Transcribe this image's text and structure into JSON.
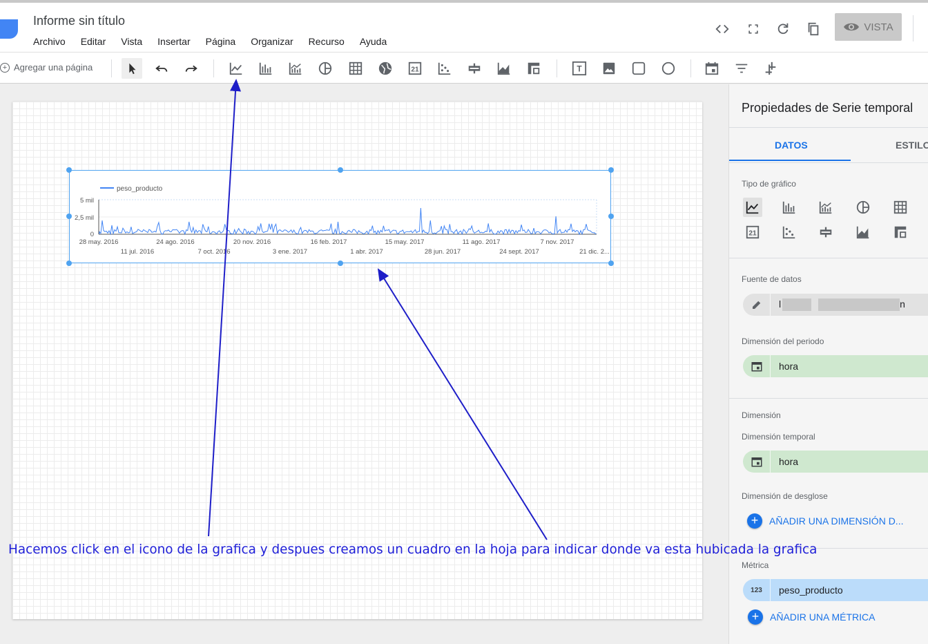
{
  "header": {
    "doc_title": "Informe sin título",
    "menu": [
      "Archivo",
      "Editar",
      "Vista",
      "Insertar",
      "Página",
      "Organizar",
      "Recurso",
      "Ayuda"
    ],
    "view_button": "VISTA"
  },
  "toolbar": {
    "add_page": "Agregar una página"
  },
  "chart": {
    "legend": "peso_producto",
    "y_ticks": [
      "5 mil",
      "2,5 mil",
      "0"
    ],
    "x_ticks_top": [
      "28 may. 2016",
      "24 ago. 2016",
      "20 nov. 2016",
      "16 feb. 2017",
      "15 may. 2017",
      "11 ago. 2017",
      "7 nov. 2017"
    ],
    "x_ticks_bottom": [
      "11 jul. 2016",
      "7 oct. 2016",
      "3 ene. 2017",
      "1 abr. 2017",
      "28 jun. 2017",
      "24 sept. 2017",
      "21 dic. 2..."
    ],
    "line_color": "#4285f4"
  },
  "panel": {
    "title": "Propiedades de Serie temporal",
    "tab_data": "DATOS",
    "tab_style": "ESTILO",
    "chart_type_label": "Tipo de gráfico",
    "source_label": "Fuente de datos",
    "source_visible_start": "l",
    "source_visible_end": "n",
    "period_dim_label": "Dimensión del periodo",
    "period_dim_value": "hora",
    "dimension_label": "Dimensión",
    "time_dim_label": "Dimensión temporal",
    "time_dim_value": "hora",
    "breakdown_label": "Dimensión de desglose",
    "add_dimension": "AÑADIR UNA DIMENSIÓN D...",
    "metric_label": "Métrica",
    "metric_value": "peso_producto",
    "metric_badge": "123",
    "add_metric": "AÑADIR UNA MÉTRICA"
  },
  "annotation": {
    "text": "Hacemos click en el icono de la grafica y despues creamos un cuadro en la hoja para indicar donde va esta hubicada la grafica",
    "color": "#2020d8"
  }
}
